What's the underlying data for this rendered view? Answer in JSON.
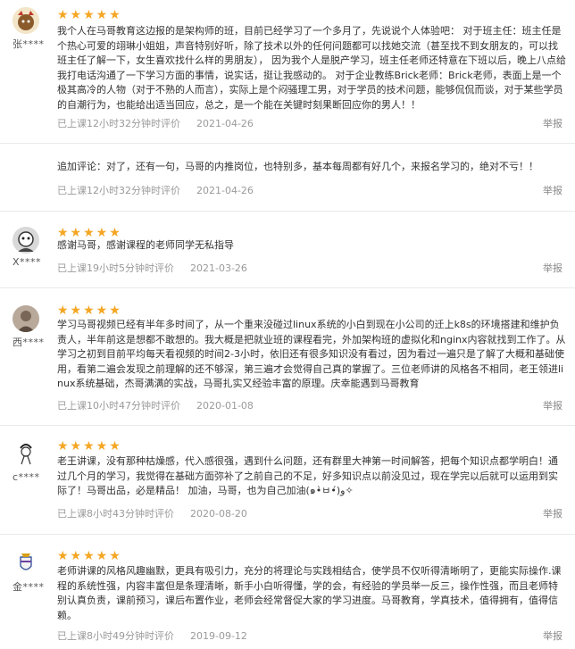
{
  "reviews": [
    {
      "user": "张****",
      "stars": "★★★★★",
      "text": "我个人在马哥教育这边报的是架构师的班，目前已经学习了一个多月了，先说说个人体验吧： 对于班主任：班主任是个热心可爱的翊琳小姐姐，声音特别好听，除了技术以外的任何问题都可以找她交流（甚至找不到女朋友的，可以找班主任了解一下，女生喜欢找什么样的男朋友）， 因为我个人是脱产学习，班主任老师还特意在下班以后，晚上八点给我打电话沟通了一下学习方面的事情，说实话，挺让我感动的。 对于企业教练Brick老师：Brick老师，表面上是一个极其高冷的人物（对于不熟的人而言），实际上是个闷骚理工男，对于学员的技术问题，能够侃侃而谈，对于某些学员的自潮行为，也能给出适当回应，总之，是一个能在关键时刻果断回应你的男人！！",
      "time": "已上课12小时32分钟时评价",
      "date": "2021-04-26",
      "report": "举报"
    },
    {
      "text": "追加评论：对了，还有一句，马哥的内推岗位，也特别多，基本每周都有好几个，来报名学习的，绝对不亏！！",
      "time": "已上课12小时32分钟时评价",
      "date": "2021-04-26",
      "report": "举报"
    },
    {
      "user": "X****",
      "stars": "★★★★★",
      "text": "感谢马哥，感谢课程的老师同学无私指导",
      "time": "已上课19小时5分钟时评价",
      "date": "2021-03-26",
      "report": "举报"
    },
    {
      "user": "西****",
      "stars": "★★★★★",
      "text": "学习马哥视频已经有半年多时间了，从一个重来没碰过linux系统的小白到现在小公司的迁上k8s的环境搭建和维护负责人，半年前这是想都不敢想的。我大概是把就业班的课程看完，外加架构班的虚拟化和nginx内容就找到工作了。从学习之初到目前平均每天看视频的时间2-3小时，依旧还有很多知识没有看过，因为看过一遍只是了解了大概和基础使用，看第二遍会发现之前理解的还不够深，第三遍才会觉得自己真的掌握了。三位老师讲的风格各不相同，老王领进linux系统基础，杰哥满满的实战，马哥扎实又经验丰富的原理。庆幸能遇到马哥教育",
      "time": "已上课10小时47分钟时评价",
      "date": "2020-01-08",
      "report": "举报"
    },
    {
      "user": "c****",
      "stars": "★★★★★",
      "text": "老王讲课，没有那种枯燥感，代入感很强，遇到什么问题，还有群里大神第一时间解答，把每个知识点都学明白！通过几个月的学习，我觉得在基础方面弥补了之前自己的不足，好多知识点以前没见过，现在学完以后就可以运用到实际了！马哥出品，必是精品！ 加油，马哥，也为自己加油(๑•̀ㅂ•́)و✧",
      "time": "已上课8小时43分钟时评价",
      "date": "2020-08-20",
      "report": "举报"
    },
    {
      "user": "金****",
      "stars": "★★★★★",
      "text": "老师讲课的风格风趣幽默，更具有吸引力，充分的将理论与实践相结合，使学员不仅听得清晰明了，更能实际操作.课程的系统性强，内容丰富但是条理清晰，新手小白听得懂，学的会，有经验的学员举一反三，操作性强，而且老师特别认真负责，课前预习，课后布置作业，老师会经常督促大家的学习进度。马哥教育，学真技术，值得拥有，值得信赖。",
      "time": "已上课8小时49分钟时评价",
      "date": "2019-09-12",
      "report": "举报"
    }
  ]
}
